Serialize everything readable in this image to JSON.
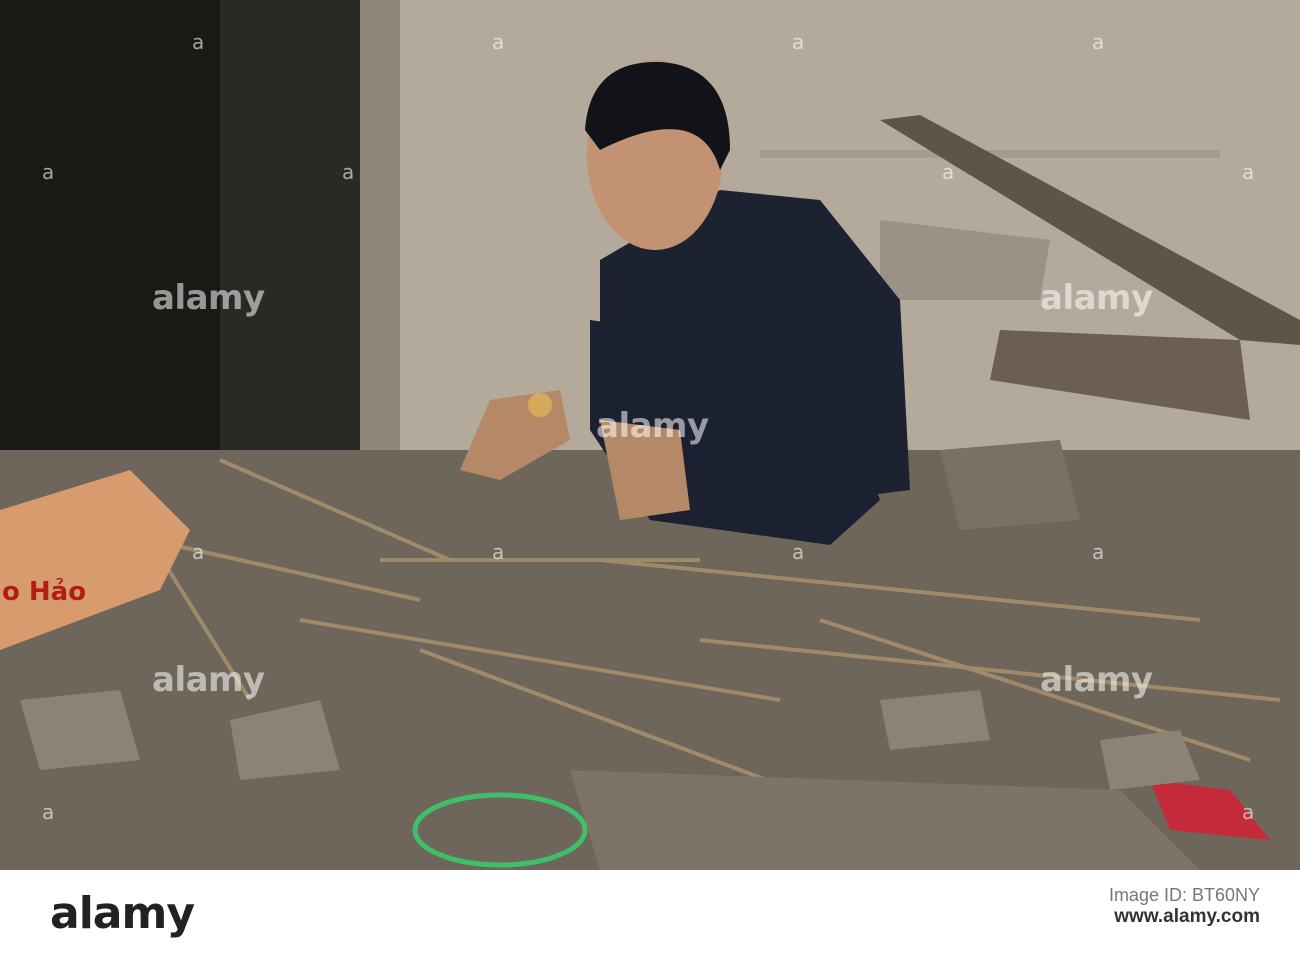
{
  "photo": {
    "box_print": "o Hảo",
    "watermark_text": "alamy",
    "watermark_center_text": "alamy",
    "watermark_small": "a"
  },
  "footer": {
    "logo": "alamy",
    "stock_line1": "Image ID: BT60NY",
    "stock_line2": "www.alamy.com",
    "stock_line3": ""
  }
}
